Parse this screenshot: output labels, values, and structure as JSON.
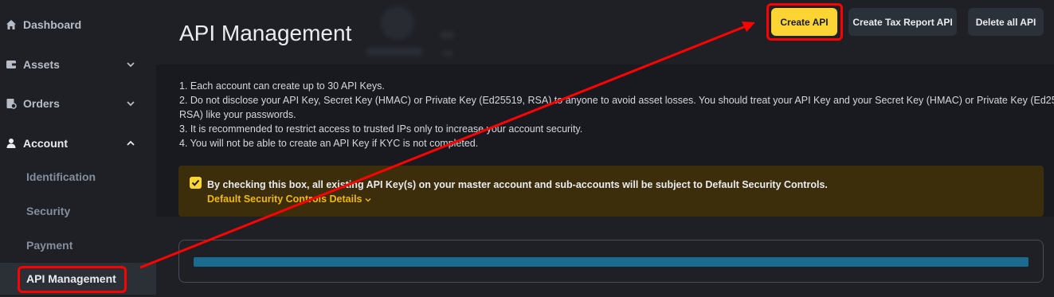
{
  "sidebar": {
    "items": [
      {
        "label": "Dashboard",
        "icon": "home-icon"
      },
      {
        "label": "Assets",
        "icon": "wallet-icon",
        "chevron": "down"
      },
      {
        "label": "Orders",
        "icon": "orders-icon",
        "chevron": "down"
      },
      {
        "label": "Account",
        "icon": "user-icon",
        "chevron": "up"
      }
    ],
    "subitems": [
      {
        "label": "Identification"
      },
      {
        "label": "Security"
      },
      {
        "label": "Payment"
      },
      {
        "label": "API Management",
        "active": true
      }
    ]
  },
  "header": {
    "title": "API Management",
    "buttons": {
      "create_api": "Create API",
      "create_tax": "Create Tax Report API",
      "delete_all": "Delete all API"
    }
  },
  "notes": [
    "1. Each account can create up to 30 API Keys.",
    "2. Do not disclose your API Key, Secret Key (HMAC) or Private Key (Ed25519, RSA) to anyone to avoid asset losses. You should treat your API Key and your Secret Key (HMAC) or Private Key (Ed25519,",
    "RSA) like your passwords.",
    "3. It is recommended to restrict access to trusted IPs only to increase your account security.",
    "4. You will not be able to create an API Key if KYC is not completed."
  ],
  "security_controls": {
    "checked": true,
    "text": "By checking this box, all existing API Key(s) on your master account and sub-accounts will be subject to Default Security Controls.",
    "link": "Default Security Controls Details"
  },
  "colors": {
    "accent": "#fcd535",
    "annotation": "#ff0000",
    "background": "#181a20"
  }
}
